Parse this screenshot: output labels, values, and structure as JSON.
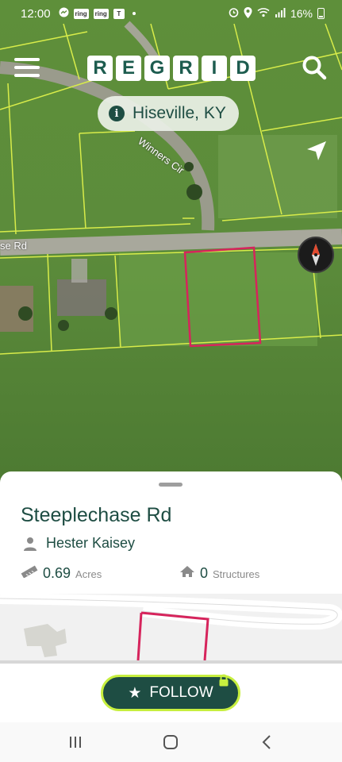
{
  "status_bar": {
    "time": "12:00",
    "apps": [
      "ring",
      "ring",
      "T"
    ],
    "battery": "16%"
  },
  "map": {
    "logo_letters": [
      "R",
      "E",
      "G",
      "R",
      "I",
      "D"
    ],
    "location": "Hiseville, KY",
    "road_labels": {
      "winners": "Winners Cir",
      "steeple": "se Rd"
    },
    "colors": {
      "brand": "#1e4d43",
      "parcel_line": "#d8ec4a",
      "selected_parcel": "#d6245c",
      "follow_border": "#c7ef3f"
    }
  },
  "sheet": {
    "title": "Steeplechase Rd",
    "owner": "Hester Kaisey",
    "acres_value": "0.69",
    "acres_unit": "Acres",
    "structures_value": "0",
    "structures_unit": "Structures"
  },
  "follow": {
    "label": "FOLLOW"
  },
  "icons": {
    "menu": "hamburger-menu-icon",
    "search": "search-icon",
    "info": "info-icon",
    "navigate": "navigation-arrow-icon",
    "compass": "compass-icon",
    "person": "person-icon",
    "ruler": "ruler-icon",
    "home": "home-icon",
    "star": "star-icon",
    "lock": "lock-icon"
  }
}
